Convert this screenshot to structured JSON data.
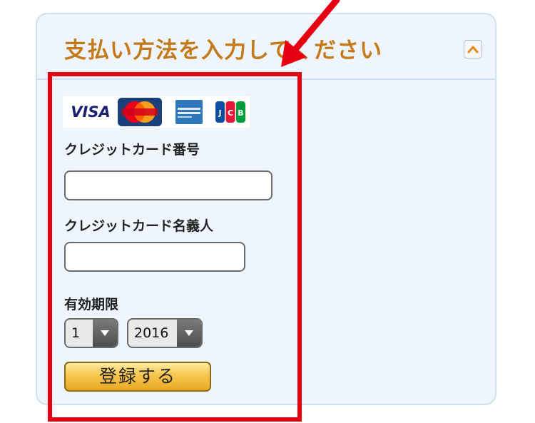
{
  "panel": {
    "title": "支払い方法を入力してください",
    "collapse_icon": "chevron-up-icon"
  },
  "card_logos": {
    "visa": "VISA",
    "mastercard": "MasterCard",
    "amex": "American Express",
    "jcb": "JCB"
  },
  "form": {
    "card_number_label": "クレジットカード番号",
    "card_number_value": "",
    "card_holder_label": "クレジットカード名義人",
    "card_holder_value": "",
    "expiry_label": "有効期限",
    "expiry_month": "1",
    "expiry_year": "2016",
    "submit_label": "登録する"
  },
  "annotation": {
    "highlight_color": "#e60012",
    "arrow_color": "#e60012"
  },
  "colors": {
    "title": "#c57a1a",
    "panel_bg": "#eef5fd",
    "panel_border": "#cfe0f2",
    "button_gold": "#f6c64d"
  }
}
